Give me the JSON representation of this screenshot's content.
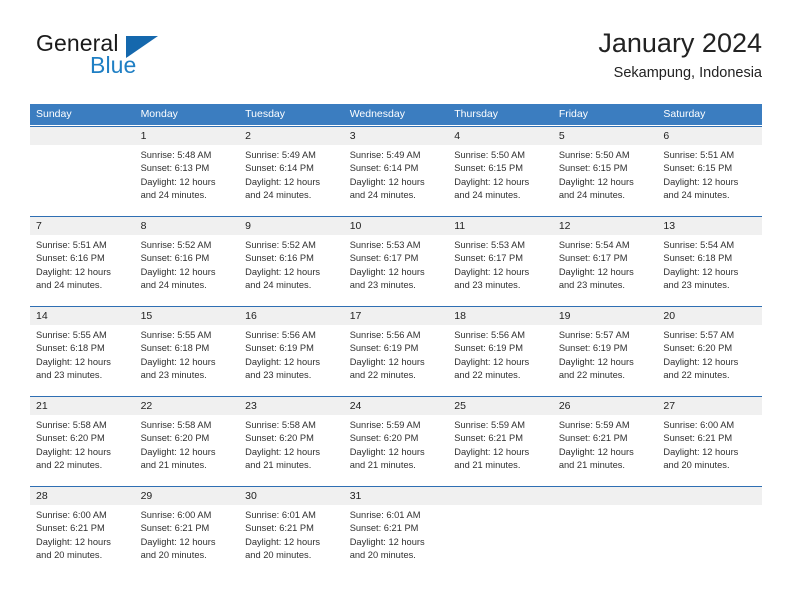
{
  "brand": {
    "name_part1": "General",
    "name_part2": "Blue",
    "triangle_color": "#1568ad",
    "blue_color": "#1f7fc4"
  },
  "header": {
    "title": "January 2024",
    "subtitle": "Sekampung, Indonesia"
  },
  "theme": {
    "header_row_bg": "#3b7dc0",
    "week_border": "#2f6fb3",
    "daynum_band_bg": "#f0f0f0",
    "text_color": "#303030"
  },
  "weekdays": [
    "Sunday",
    "Monday",
    "Tuesday",
    "Wednesday",
    "Thursday",
    "Friday",
    "Saturday"
  ],
  "weeks": [
    {
      "daynums": [
        "",
        "1",
        "2",
        "3",
        "4",
        "5",
        "6"
      ],
      "cells": [
        {
          "empty": true,
          "lines": [
            "",
            "",
            "",
            ""
          ]
        },
        {
          "empty": false,
          "lines": [
            "Sunrise: 5:48 AM",
            "Sunset: 6:13 PM",
            "Daylight: 12 hours",
            "and 24 minutes."
          ]
        },
        {
          "empty": false,
          "lines": [
            "Sunrise: 5:49 AM",
            "Sunset: 6:14 PM",
            "Daylight: 12 hours",
            "and 24 minutes."
          ]
        },
        {
          "empty": false,
          "lines": [
            "Sunrise: 5:49 AM",
            "Sunset: 6:14 PM",
            "Daylight: 12 hours",
            "and 24 minutes."
          ]
        },
        {
          "empty": false,
          "lines": [
            "Sunrise: 5:50 AM",
            "Sunset: 6:15 PM",
            "Daylight: 12 hours",
            "and 24 minutes."
          ]
        },
        {
          "empty": false,
          "lines": [
            "Sunrise: 5:50 AM",
            "Sunset: 6:15 PM",
            "Daylight: 12 hours",
            "and 24 minutes."
          ]
        },
        {
          "empty": false,
          "lines": [
            "Sunrise: 5:51 AM",
            "Sunset: 6:15 PM",
            "Daylight: 12 hours",
            "and 24 minutes."
          ]
        }
      ]
    },
    {
      "daynums": [
        "7",
        "8",
        "9",
        "10",
        "11",
        "12",
        "13"
      ],
      "cells": [
        {
          "empty": false,
          "lines": [
            "Sunrise: 5:51 AM",
            "Sunset: 6:16 PM",
            "Daylight: 12 hours",
            "and 24 minutes."
          ]
        },
        {
          "empty": false,
          "lines": [
            "Sunrise: 5:52 AM",
            "Sunset: 6:16 PM",
            "Daylight: 12 hours",
            "and 24 minutes."
          ]
        },
        {
          "empty": false,
          "lines": [
            "Sunrise: 5:52 AM",
            "Sunset: 6:16 PM",
            "Daylight: 12 hours",
            "and 24 minutes."
          ]
        },
        {
          "empty": false,
          "lines": [
            "Sunrise: 5:53 AM",
            "Sunset: 6:17 PM",
            "Daylight: 12 hours",
            "and 23 minutes."
          ]
        },
        {
          "empty": false,
          "lines": [
            "Sunrise: 5:53 AM",
            "Sunset: 6:17 PM",
            "Daylight: 12 hours",
            "and 23 minutes."
          ]
        },
        {
          "empty": false,
          "lines": [
            "Sunrise: 5:54 AM",
            "Sunset: 6:17 PM",
            "Daylight: 12 hours",
            "and 23 minutes."
          ]
        },
        {
          "empty": false,
          "lines": [
            "Sunrise: 5:54 AM",
            "Sunset: 6:18 PM",
            "Daylight: 12 hours",
            "and 23 minutes."
          ]
        }
      ]
    },
    {
      "daynums": [
        "14",
        "15",
        "16",
        "17",
        "18",
        "19",
        "20"
      ],
      "cells": [
        {
          "empty": false,
          "lines": [
            "Sunrise: 5:55 AM",
            "Sunset: 6:18 PM",
            "Daylight: 12 hours",
            "and 23 minutes."
          ]
        },
        {
          "empty": false,
          "lines": [
            "Sunrise: 5:55 AM",
            "Sunset: 6:18 PM",
            "Daylight: 12 hours",
            "and 23 minutes."
          ]
        },
        {
          "empty": false,
          "lines": [
            "Sunrise: 5:56 AM",
            "Sunset: 6:19 PM",
            "Daylight: 12 hours",
            "and 23 minutes."
          ]
        },
        {
          "empty": false,
          "lines": [
            "Sunrise: 5:56 AM",
            "Sunset: 6:19 PM",
            "Daylight: 12 hours",
            "and 22 minutes."
          ]
        },
        {
          "empty": false,
          "lines": [
            "Sunrise: 5:56 AM",
            "Sunset: 6:19 PM",
            "Daylight: 12 hours",
            "and 22 minutes."
          ]
        },
        {
          "empty": false,
          "lines": [
            "Sunrise: 5:57 AM",
            "Sunset: 6:19 PM",
            "Daylight: 12 hours",
            "and 22 minutes."
          ]
        },
        {
          "empty": false,
          "lines": [
            "Sunrise: 5:57 AM",
            "Sunset: 6:20 PM",
            "Daylight: 12 hours",
            "and 22 minutes."
          ]
        }
      ]
    },
    {
      "daynums": [
        "21",
        "22",
        "23",
        "24",
        "25",
        "26",
        "27"
      ],
      "cells": [
        {
          "empty": false,
          "lines": [
            "Sunrise: 5:58 AM",
            "Sunset: 6:20 PM",
            "Daylight: 12 hours",
            "and 22 minutes."
          ]
        },
        {
          "empty": false,
          "lines": [
            "Sunrise: 5:58 AM",
            "Sunset: 6:20 PM",
            "Daylight: 12 hours",
            "and 21 minutes."
          ]
        },
        {
          "empty": false,
          "lines": [
            "Sunrise: 5:58 AM",
            "Sunset: 6:20 PM",
            "Daylight: 12 hours",
            "and 21 minutes."
          ]
        },
        {
          "empty": false,
          "lines": [
            "Sunrise: 5:59 AM",
            "Sunset: 6:20 PM",
            "Daylight: 12 hours",
            "and 21 minutes."
          ]
        },
        {
          "empty": false,
          "lines": [
            "Sunrise: 5:59 AM",
            "Sunset: 6:21 PM",
            "Daylight: 12 hours",
            "and 21 minutes."
          ]
        },
        {
          "empty": false,
          "lines": [
            "Sunrise: 5:59 AM",
            "Sunset: 6:21 PM",
            "Daylight: 12 hours",
            "and 21 minutes."
          ]
        },
        {
          "empty": false,
          "lines": [
            "Sunrise: 6:00 AM",
            "Sunset: 6:21 PM",
            "Daylight: 12 hours",
            "and 20 minutes."
          ]
        }
      ]
    },
    {
      "daynums": [
        "28",
        "29",
        "30",
        "31",
        "",
        "",
        ""
      ],
      "cells": [
        {
          "empty": false,
          "lines": [
            "Sunrise: 6:00 AM",
            "Sunset: 6:21 PM",
            "Daylight: 12 hours",
            "and 20 minutes."
          ]
        },
        {
          "empty": false,
          "lines": [
            "Sunrise: 6:00 AM",
            "Sunset: 6:21 PM",
            "Daylight: 12 hours",
            "and 20 minutes."
          ]
        },
        {
          "empty": false,
          "lines": [
            "Sunrise: 6:01 AM",
            "Sunset: 6:21 PM",
            "Daylight: 12 hours",
            "and 20 minutes."
          ]
        },
        {
          "empty": false,
          "lines": [
            "Sunrise: 6:01 AM",
            "Sunset: 6:21 PM",
            "Daylight: 12 hours",
            "and 20 minutes."
          ]
        },
        {
          "empty": true,
          "lines": [
            "",
            "",
            "",
            ""
          ]
        },
        {
          "empty": true,
          "lines": [
            "",
            "",
            "",
            ""
          ]
        },
        {
          "empty": true,
          "lines": [
            "",
            "",
            "",
            ""
          ]
        }
      ]
    }
  ]
}
